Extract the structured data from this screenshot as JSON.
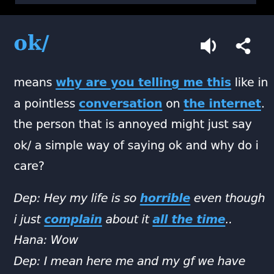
{
  "entry": {
    "word": "ok/",
    "icons": {
      "speaker": "speaker-icon",
      "share": "share-icon"
    },
    "colors": {
      "background": "#000000",
      "card": "#1e2433",
      "accent": "#3fa9f5",
      "text": "#ffffff"
    },
    "meaning": {
      "line1": {
        "t1": "means ",
        "link1": "why are you telling me this",
        "t2": " like in"
      },
      "line2": {
        "t1": "a pointless ",
        "link1": "conversation",
        "t2": " on ",
        "link2": "the internet",
        "t3": "."
      },
      "line3": "the person that is annoyed might just say",
      "line4": "ok/ a simple way of saying ok and why do i",
      "line5": "care?"
    },
    "example": {
      "line1": {
        "t1": "Dep: Hey my life is so ",
        "link1": "horrible",
        "t2": " even though"
      },
      "line2": {
        "t1": "i just ",
        "link1": "complain",
        "t2": " about it ",
        "link2": "all the time",
        "t3": ".."
      },
      "line3": "Hana: Wow",
      "line4": "Dep: I mean here me and my gf we have"
    }
  }
}
